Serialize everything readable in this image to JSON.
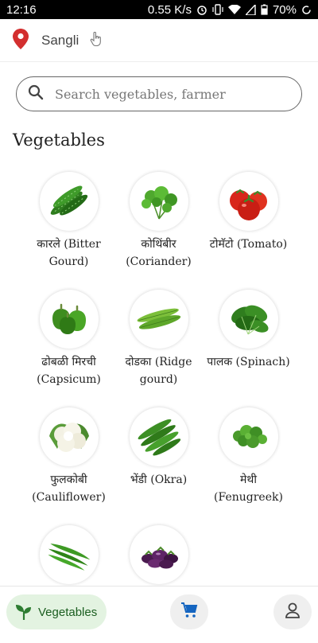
{
  "status_bar": {
    "time": "12:16",
    "speed": "0.55 K/s",
    "battery": "70%"
  },
  "location": {
    "city": "Sangli"
  },
  "search": {
    "placeholder": "Search vegetables, farmer"
  },
  "section": {
    "title": "Vegetables"
  },
  "vegetables": [
    {
      "label": "कारले (Bitter Gourd)",
      "icon": "bitter-gourd"
    },
    {
      "label": "कोथिंबीर (Coriander)",
      "icon": "coriander"
    },
    {
      "label": "टोमॅटो (Tomato)",
      "icon": "tomato"
    },
    {
      "label": "ढोबळी मिरची (Capsicum)",
      "icon": "capsicum"
    },
    {
      "label": "दोडका (Ridge gourd)",
      "icon": "ridge-gourd"
    },
    {
      "label": "पालक (Spinach)",
      "icon": "spinach"
    },
    {
      "label": "फुलकोबी (Cauliflower)",
      "icon": "cauliflower"
    },
    {
      "label": "भेंडी (Okra)",
      "icon": "okra"
    },
    {
      "label": "मेथी (Fenugreek)",
      "icon": "fenugreek"
    },
    {
      "label": "",
      "icon": "green-chilli"
    },
    {
      "label": "",
      "icon": "brinjal"
    }
  ],
  "bottom_nav": {
    "vegetables_label": "Vegetables"
  },
  "colors": {
    "accent_green": "#2e7d32",
    "pin_red": "#d32f2f",
    "tab_active_bg": "#e3f3e1"
  }
}
